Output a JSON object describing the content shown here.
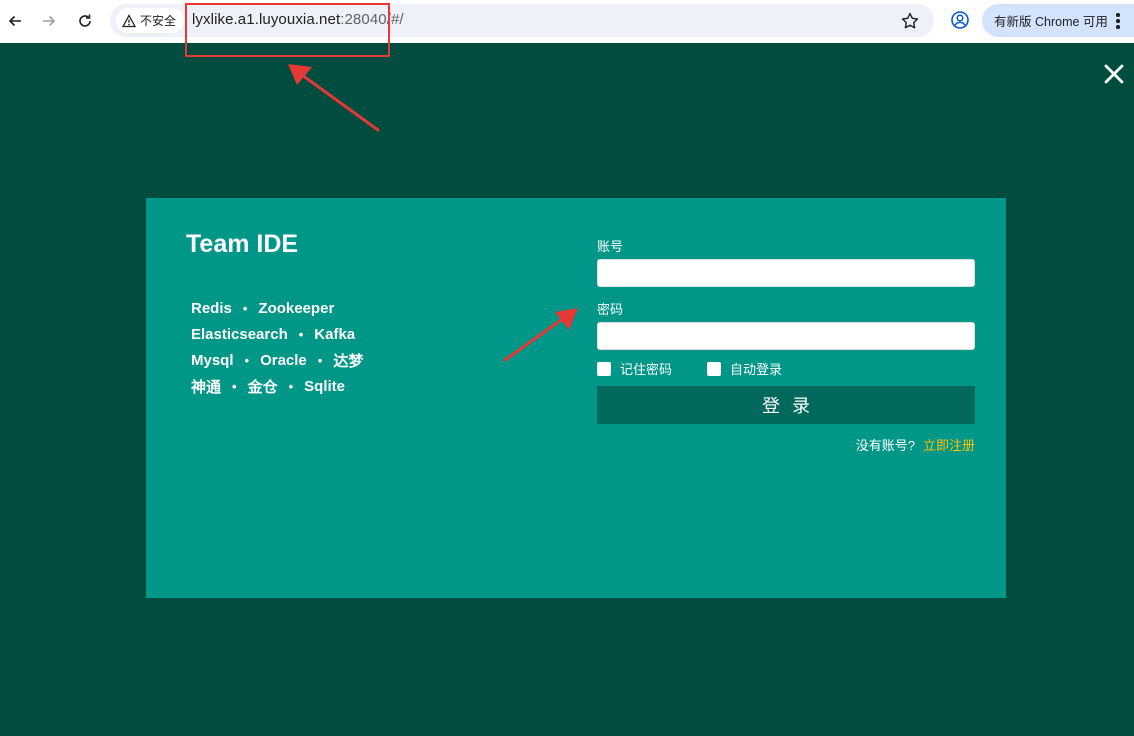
{
  "browser": {
    "security_label": "不安全",
    "url_host": "lyxlike.a1.luyouxia.net",
    "url_rest": ":28040/#/",
    "update_chip_label": "有新版 Chrome 可用"
  },
  "login": {
    "brand_title": "Team IDE",
    "databases": [
      [
        "Redis",
        "Zookeeper"
      ],
      [
        "Elasticsearch",
        "Kafka"
      ],
      [
        "Mysql",
        "Oracle",
        "达梦"
      ],
      [
        "神通",
        "金仓",
        "Sqlite"
      ]
    ],
    "separator": "•",
    "account_label": "账号",
    "password_label": "密码",
    "account_value": "",
    "password_value": "",
    "remember_label": "记住密码",
    "auto_login_label": "自动登录",
    "submit_label": "登录",
    "no_account_text": "没有账号?",
    "register_link": "立即注册"
  },
  "colors": {
    "page_background": "#004d40",
    "panel_background": "#009688",
    "button_background": "#00695c",
    "register_link": "#ffc107",
    "annotation_red": "#e53935"
  }
}
